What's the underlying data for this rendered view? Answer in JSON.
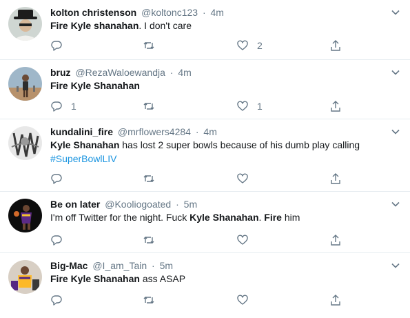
{
  "colors": {
    "text": "#14171a",
    "secondary": "#657786",
    "link": "#1b95e0",
    "divider": "#e6ecf0"
  },
  "icons": [
    "reply-icon",
    "retweet-icon",
    "like-icon",
    "share-icon",
    "chevron-down-icon"
  ],
  "tweets": [
    {
      "name": "kolton christenson",
      "handle": "@koltonc123",
      "dot": "·",
      "time": "4m",
      "text": [
        {
          "t": "Fire Kyle shanahan",
          "b": true
        },
        {
          "t": ". I don't care",
          "b": false
        }
      ],
      "replies": "",
      "retweets": "",
      "likes": "2"
    },
    {
      "name": "bruz",
      "handle": "@RezaWaloewandja",
      "dot": "·",
      "time": "4m",
      "text": [
        {
          "t": "Fire Kyle Shanahan",
          "b": true
        }
      ],
      "replies": "1",
      "retweets": "",
      "likes": "1"
    },
    {
      "name": "kundalini_fire",
      "handle": "@mrflowers4284",
      "dot": "·",
      "time": "4m",
      "text": [
        {
          "t": "Kyle Shanahan",
          "b": true
        },
        {
          "t": " has lost 2 super bowls because of his dumb play calling",
          "b": false
        },
        {
          "t": "\n",
          "b": false
        },
        {
          "t": "#SuperBowlLIV",
          "b": false,
          "tag": true
        }
      ],
      "replies": "",
      "retweets": "",
      "likes": ""
    },
    {
      "name": "Be on later",
      "handle": "@Kooliogoated",
      "dot": "·",
      "time": "5m",
      "text": [
        {
          "t": "I'm off Twitter for the night. Fuck ",
          "b": false
        },
        {
          "t": "Kyle Shanahan",
          "b": true
        },
        {
          "t": ". ",
          "b": false
        },
        {
          "t": "Fire",
          "b": true
        },
        {
          "t": " him",
          "b": false
        }
      ],
      "replies": "",
      "retweets": "",
      "likes": ""
    },
    {
      "name": "Big-Mac",
      "handle": "@I_am_Tain",
      "dot": "·",
      "time": "5m",
      "text": [
        {
          "t": "Fire Kyle Shanahan",
          "b": true
        },
        {
          "t": " ass ASAP",
          "b": false
        }
      ],
      "replies": "",
      "retweets": "",
      "likes": ""
    }
  ]
}
